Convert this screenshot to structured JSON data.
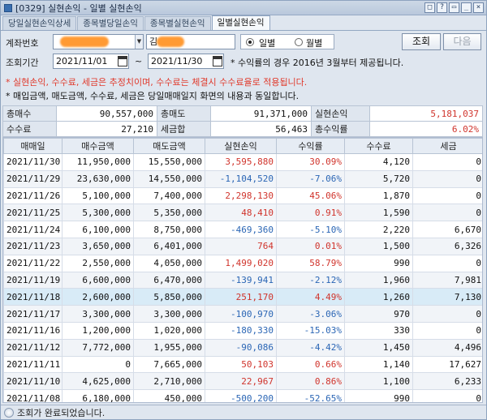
{
  "window": {
    "title": "[0329] 실현손익 - 일별 실현손익",
    "buttons": [
      "□",
      "?",
      "▭",
      "_",
      "×"
    ]
  },
  "tabs": [
    {
      "label": "당일실현손익상세",
      "active": false
    },
    {
      "label": "종목별당일손익",
      "active": false
    },
    {
      "label": "종목별실현손익",
      "active": false
    },
    {
      "label": "일별실현손익",
      "active": true
    }
  ],
  "form": {
    "account_label": "계좌번호",
    "account_value": "",
    "account_name": "김",
    "radio_daily": "일별",
    "radio_monthly": "월별",
    "query_button": "조회",
    "next_button": "다음",
    "period_label": "조회기간",
    "date_from": "2021/11/01",
    "date_to": "2021/11/30",
    "tilde": "~",
    "info_note": "* 수익률의 경우 2016년 3월부터 제공됩니다.",
    "warn_note": "* 실현손익, 수수료, 세금은 추정치이며, 수수료는 체결시 수수료율로 적용됩니다.",
    "detail_note": "* 매입금액, 매도금액, 수수료, 세금은 당일매매일지 화면의 내용과 동일합니다."
  },
  "summary": {
    "total_buy_label": "총매수",
    "total_buy": "90,557,000",
    "total_sell_label": "총매도",
    "total_sell": "91,371,000",
    "realized_label": "실현손익",
    "realized": "5,181,037",
    "fee_label": "수수료",
    "fee": "27,210",
    "tax_label": "세금합",
    "tax": "56,463",
    "return_label": "총수익률",
    "return": "6.02%"
  },
  "grid": {
    "headers": [
      "매매일",
      "매수금액",
      "매도금액",
      "실현손익",
      "수익률",
      "수수료",
      "세금"
    ],
    "rows": [
      {
        "date": "2021/11/30",
        "buy": "11,950,000",
        "sell": "15,550,000",
        "pnl": "3,595,880",
        "rate": "30.09%",
        "fee": "4,120",
        "tax": "0",
        "sign": "pos"
      },
      {
        "date": "2021/11/29",
        "buy": "23,630,000",
        "sell": "14,550,000",
        "pnl": "-1,104,520",
        "rate": "-7.06%",
        "fee": "5,720",
        "tax": "0",
        "sign": "neg"
      },
      {
        "date": "2021/11/26",
        "buy": "5,100,000",
        "sell": "7,400,000",
        "pnl": "2,298,130",
        "rate": "45.06%",
        "fee": "1,870",
        "tax": "0",
        "sign": "pos"
      },
      {
        "date": "2021/11/25",
        "buy": "5,300,000",
        "sell": "5,350,000",
        "pnl": "48,410",
        "rate": "0.91%",
        "fee": "1,590",
        "tax": "0",
        "sign": "pos"
      },
      {
        "date": "2021/11/24",
        "buy": "6,100,000",
        "sell": "8,750,000",
        "pnl": "-469,360",
        "rate": "-5.10%",
        "fee": "2,220",
        "tax": "6,670",
        "sign": "neg"
      },
      {
        "date": "2021/11/23",
        "buy": "3,650,000",
        "sell": "6,401,000",
        "pnl": "764",
        "rate": "0.01%",
        "fee": "1,500",
        "tax": "6,326",
        "sign": "pos"
      },
      {
        "date": "2021/11/22",
        "buy": "2,550,000",
        "sell": "4,050,000",
        "pnl": "1,499,020",
        "rate": "58.79%",
        "fee": "990",
        "tax": "0",
        "sign": "pos"
      },
      {
        "date": "2021/11/19",
        "buy": "6,600,000",
        "sell": "6,470,000",
        "pnl": "-139,941",
        "rate": "-2.12%",
        "fee": "1,960",
        "tax": "7,981",
        "sign": "neg"
      },
      {
        "date": "2021/11/18",
        "buy": "2,600,000",
        "sell": "5,850,000",
        "pnl": "251,170",
        "rate": "4.49%",
        "fee": "1,260",
        "tax": "7,130",
        "sign": "pos",
        "selected": true
      },
      {
        "date": "2021/11/17",
        "buy": "3,300,000",
        "sell": "3,300,000",
        "pnl": "-100,970",
        "rate": "-3.06%",
        "fee": "970",
        "tax": "0",
        "sign": "neg"
      },
      {
        "date": "2021/11/16",
        "buy": "1,200,000",
        "sell": "1,020,000",
        "pnl": "-180,330",
        "rate": "-15.03%",
        "fee": "330",
        "tax": "0",
        "sign": "neg"
      },
      {
        "date": "2021/11/12",
        "buy": "7,772,000",
        "sell": "1,955,000",
        "pnl": "-90,086",
        "rate": "-4.42%",
        "fee": "1,450",
        "tax": "4,496",
        "sign": "neg"
      },
      {
        "date": "2021/11/11",
        "buy": "0",
        "sell": "7,665,000",
        "pnl": "50,103",
        "rate": "0.66%",
        "fee": "1,140",
        "tax": "17,627",
        "sign": "pos"
      },
      {
        "date": "2021/11/10",
        "buy": "4,625,000",
        "sell": "2,710,000",
        "pnl": "22,967",
        "rate": "0.86%",
        "fee": "1,100",
        "tax": "6,233",
        "sign": "pos"
      },
      {
        "date": "2021/11/08",
        "buy": "6,180,000",
        "sell": "450,000",
        "pnl": "-500,200",
        "rate": "-52.65%",
        "fee": "990",
        "tax": "0",
        "sign": "neg"
      }
    ]
  },
  "status": {
    "message": "조회가 완료되었습니다."
  }
}
